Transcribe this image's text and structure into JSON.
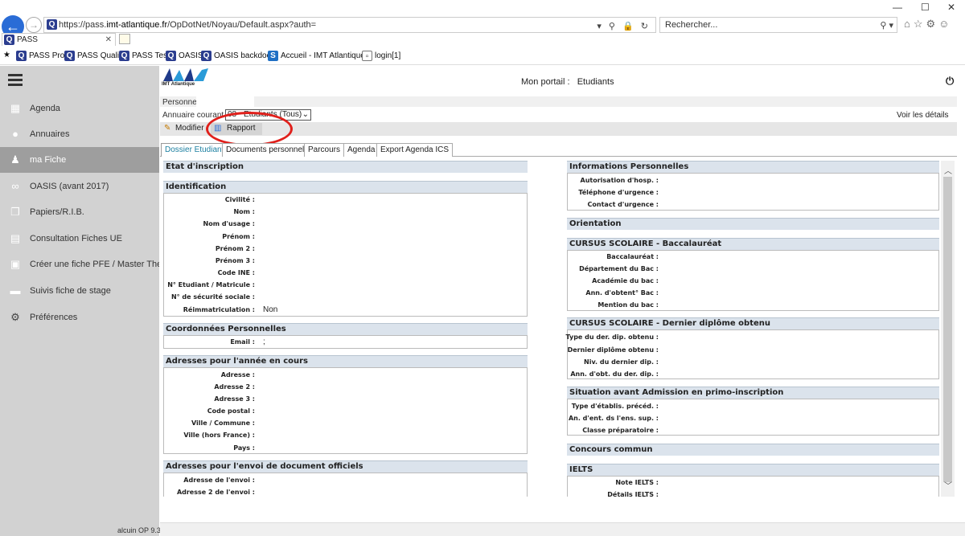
{
  "browser": {
    "url_prefix": "https://pass.",
    "url_domain": "imt-atlantique.fr",
    "url_path": "/OpDotNet/Noyau/Default.aspx?auth=",
    "search_placeholder": "Rechercher...",
    "tab_title": "PASS",
    "favorites": [
      "PASS Prod",
      "PASS Qualif",
      "PASS Test",
      "OASIS",
      "OASIS backdoor",
      "Accueil - IMT Atlantique",
      "login[1]"
    ]
  },
  "sidebar": {
    "items": [
      {
        "label": "Agenda",
        "icon": "calendar-icon"
      },
      {
        "label": "Annuaires",
        "icon": "users-icon"
      },
      {
        "label": "ma Fiche",
        "icon": "user-icon"
      },
      {
        "label": "OASIS (avant 2017)",
        "icon": "link-icon"
      },
      {
        "label": "Papiers/R.I.B.",
        "icon": "copy-icon"
      },
      {
        "label": "Consultation Fiches UE",
        "icon": "id-card-icon"
      },
      {
        "label": "Créer une fiche PFE / Master Thesis",
        "icon": "card-icon"
      },
      {
        "label": "Suivis fiche de stage",
        "icon": "folder-icon"
      },
      {
        "label": "Préférences",
        "icon": "gear-icon"
      }
    ],
    "version": "alcuin OP 9.3"
  },
  "header": {
    "logo_text": "IMT Atlantique",
    "portal_label": "Mon portail :",
    "portal_value": "Etudiants"
  },
  "filters": {
    "personne_label": "Personne :",
    "annuaire_label": "Annuaire courant :",
    "annuaire_value": "08 - Etudiants (Tous)",
    "details_link": "Voir les détails"
  },
  "toolbar": {
    "modifier": "Modifier",
    "rapport": "Rapport"
  },
  "tabs": [
    "Dossier Etudiant",
    "Documents personnels",
    "Parcours",
    "Agenda",
    "Export Agenda ICS"
  ],
  "left": {
    "etat": "Etat d'inscription",
    "identification": {
      "title": "Identification",
      "fields": [
        "Civilité :",
        "Nom :",
        "Nom d'usage :",
        "Prénom :",
        "Prénom 2 :",
        "Prénom 3 :",
        "Code INE :",
        "N° Etudiant / Matricule :",
        "N° de sécurité sociale :",
        "Réimmatriculation :"
      ],
      "reimm_value": "Non"
    },
    "coordonnees": {
      "title": "Coordonnées Personnelles",
      "email_label": "Email :",
      "email_value": ";"
    },
    "adresses": {
      "title": "Adresses pour l'année en cours",
      "fields": [
        "Adresse :",
        "Adresse 2 :",
        "Adresse 3 :",
        "Code postal :",
        "Ville / Commune :",
        "Ville (hors France) :",
        "Pays :"
      ]
    },
    "envoi": {
      "title": "Adresses pour l'envoi de document officiels",
      "fields": [
        "Adresse de l'envoi :",
        "Adresse 2 de l'envoi :"
      ]
    }
  },
  "right": {
    "infos": {
      "title": "Informations Personnelles",
      "fields": [
        "Autorisation d'hosp. :",
        "Téléphone d'urgence :",
        "Contact d'urgence :"
      ]
    },
    "orientation": "Orientation",
    "bac": {
      "title": "CURSUS SCOLAIRE - Baccalauréat",
      "fields": [
        "Baccalauréat :",
        "Département du Bac :",
        "Académie du bac :",
        "Ann. d'obtent° Bac :",
        "Mention du bac :"
      ]
    },
    "diplome": {
      "title": "CURSUS SCOLAIRE - Dernier diplôme obtenu",
      "fields": [
        "Type du der. dip. obtenu :",
        "Dernier diplôme obtenu :",
        "Niv. du dernier dip. :",
        "Ann. d'obt. du der. dip. :"
      ]
    },
    "situation": {
      "title": "Situation avant Admission en primo-inscription",
      "fields": [
        "Type d'établis. précéd. :",
        "An. d'ent. ds l'ens. sup. :",
        "Classe préparatoire :"
      ]
    },
    "concours": "Concours commun",
    "ielts": {
      "title": "IELTS",
      "fields": [
        "Note IELTS :",
        "Détails IELTS :"
      ]
    }
  }
}
